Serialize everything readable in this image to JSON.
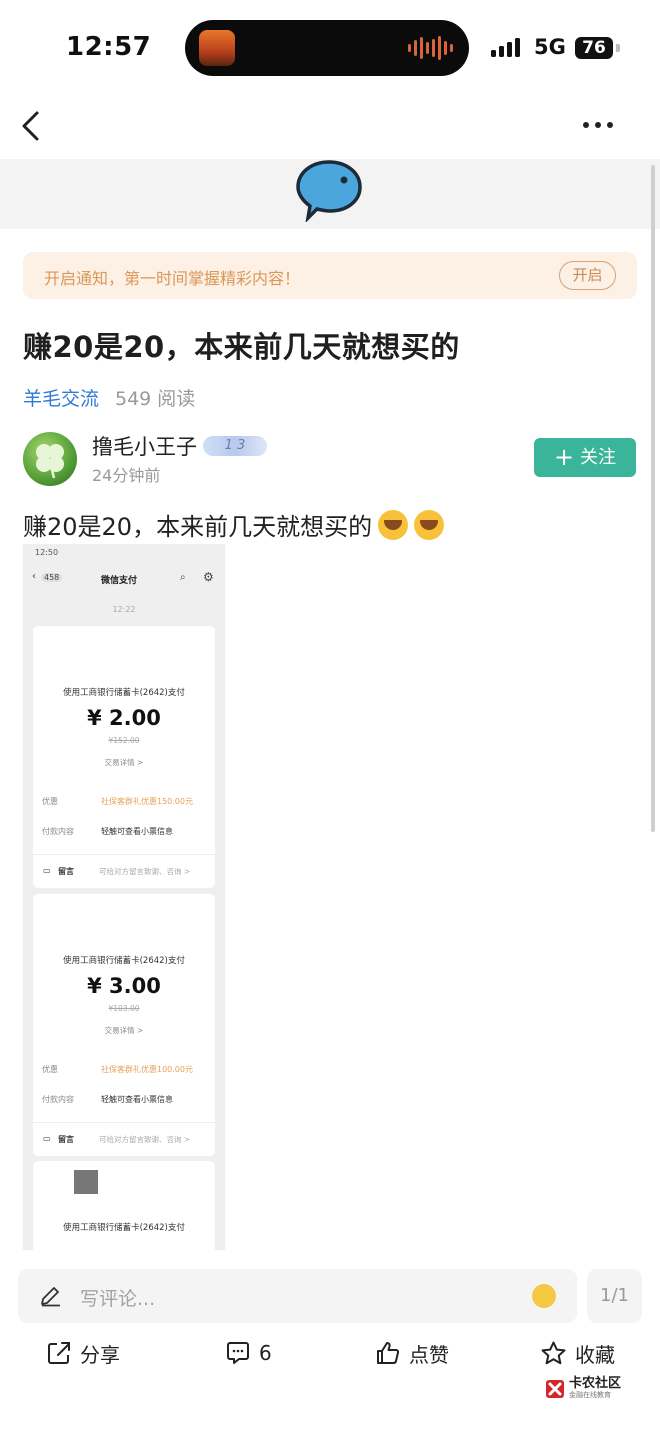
{
  "status_bar": {
    "time": "12:57",
    "network": "5G",
    "battery": "76"
  },
  "notify": {
    "text": "开启通知，第一时间掌握精彩内容！",
    "button": "开启"
  },
  "post": {
    "title": "赚20是20，本来前几天就想买的",
    "category": "羊毛交流",
    "views": "549 阅读",
    "body": "赚20是20，本来前几天就想买的"
  },
  "author": {
    "name": "撸毛小王子",
    "badge": "1 3",
    "time": "24分钟前",
    "follow_label": "关注"
  },
  "screenshot": {
    "time": "12:50",
    "back_count": "458",
    "title": "微信支付",
    "stamp": "12:22",
    "payments": [
      {
        "method": "使用工商银行储蓄卡(2642)支付",
        "amount": "¥ 2.00",
        "original": "¥152.00",
        "detail_link": "交易详情 >",
        "discount_label": "优惠",
        "discount_value": "社保客群礼优惠150.00元",
        "content_label": "付款内容",
        "content_value": "轻触可查看小票信息",
        "message_label": "留言",
        "message_hint": "可给对方留言致谢、咨询 >"
      },
      {
        "method": "使用工商银行储蓄卡(2642)支付",
        "amount": "¥ 3.00",
        "original": "¥103.00",
        "detail_link": "交易详情 >",
        "discount_label": "优惠",
        "discount_value": "社保客群礼优惠100.00元",
        "content_label": "付款内容",
        "content_value": "轻触可查看小票信息",
        "message_label": "留言",
        "message_hint": "可给对方留言致谢、咨询 >"
      },
      {
        "method": "使用工商银行储蓄卡(2642)支付"
      }
    ]
  },
  "comment": {
    "placeholder": "写评论...",
    "page_indicator": "1/1"
  },
  "actions": {
    "share": "分享",
    "comments": "6",
    "like": "点赞",
    "favorite": "收藏"
  },
  "brand": {
    "name": "卡农社区",
    "sub": "金融在线教育"
  },
  "colors": {
    "accent": "#3bb59a",
    "link": "#2e7ad6",
    "notify_bg": "#fdf1e6",
    "notify_text": "#d99758"
  }
}
